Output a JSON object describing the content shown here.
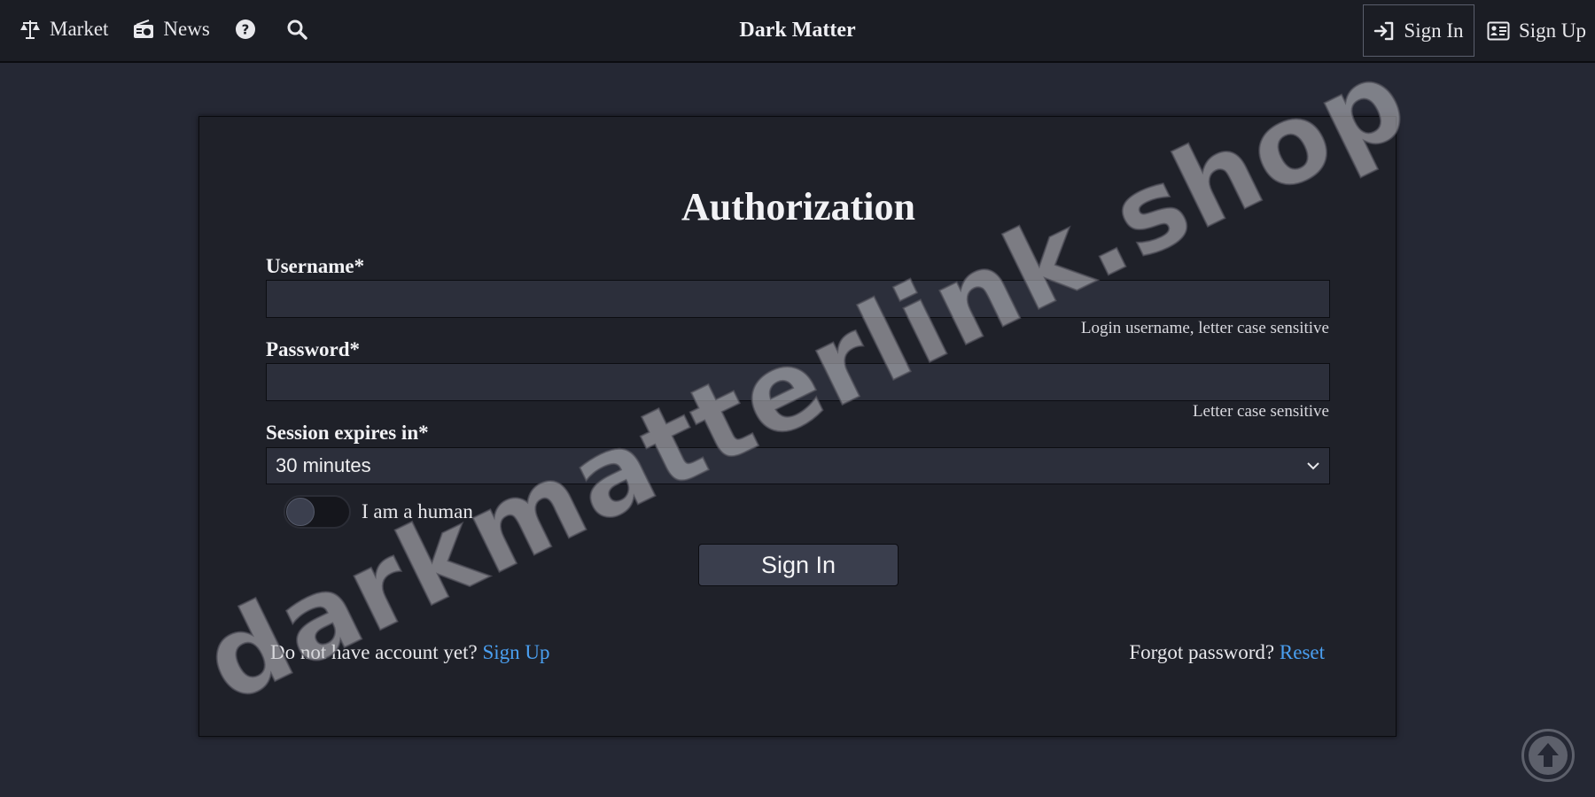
{
  "nav": {
    "market_label": "Market",
    "news_label": "News",
    "help_icon": "question-circle-icon",
    "search_icon": "search-icon",
    "brand": "Dark Matter",
    "signin_label": "Sign In",
    "signup_label": "Sign Up"
  },
  "form": {
    "title": "Authorization",
    "username_label": "Username*",
    "username_value": "",
    "username_hint": "Login username, letter case sensitive",
    "password_label": "Password*",
    "password_value": "",
    "password_hint": "Letter case sensitive",
    "session_label": "Session expires in*",
    "session_value": "30 minutes",
    "human_label": "I am a human",
    "human_checked": false,
    "submit_label": "Sign In"
  },
  "footer": {
    "no_account_text": "Do not have account yet?",
    "signup_link": "Sign Up",
    "forgot_text": "Forgot password?",
    "reset_link": "Reset"
  },
  "watermark": "darkmatterlink.shop",
  "colors": {
    "background": "#252834",
    "card": "#1f2129",
    "topbar": "#1b1d24",
    "link": "#4a9ff0"
  }
}
